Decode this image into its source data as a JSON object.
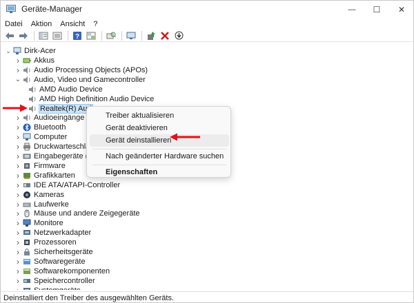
{
  "window": {
    "title": "Geräte-Manager",
    "controls": {
      "minimize": "—",
      "maximize": "☐",
      "close": "✕"
    }
  },
  "menubar": {
    "items": [
      "Datei",
      "Aktion",
      "Ansicht",
      "?"
    ]
  },
  "toolbar": {
    "buttons": [
      "back-arrow-icon",
      "forward-arrow-icon",
      "properties-view-icon",
      "list-view-icon",
      "help-icon",
      "grid-view-icon",
      "scan-hardware-icon",
      "monitor-icon",
      "add-driver-icon",
      "remove-device-icon",
      "download-icon"
    ]
  },
  "tree": {
    "root": "Dirk-Acer",
    "items": [
      {
        "label": "Akkus",
        "icon": "battery-icon",
        "expanded": false
      },
      {
        "label": "Audio Processing Objects (APOs)",
        "icon": "speaker-icon",
        "expanded": false
      },
      {
        "label": "Audio, Video und Gamecontroller",
        "icon": "speaker-icon",
        "expanded": true
      },
      {
        "label": "AMD Audio Device",
        "icon": "speaker-icon",
        "child": true
      },
      {
        "label": "AMD High Definition Audio Device",
        "icon": "speaker-icon",
        "child": true
      },
      {
        "label": "Realtek(R) Aud",
        "icon": "speaker-icon",
        "child": true,
        "selected": true
      },
      {
        "label": "Audioeingänge ur",
        "icon": "speaker-icon",
        "expanded": false
      },
      {
        "label": "Bluetooth",
        "icon": "bluetooth-icon",
        "expanded": false
      },
      {
        "label": "Computer",
        "icon": "computer-icon",
        "expanded": false
      },
      {
        "label": "Druckwarteschlang",
        "icon": "printer-icon",
        "expanded": false
      },
      {
        "label": "Eingabegeräte (Hu",
        "icon": "keyboard-icon",
        "expanded": false
      },
      {
        "label": "Firmware",
        "icon": "chip-icon",
        "expanded": false
      },
      {
        "label": "Grafikkarten",
        "icon": "display-adapter-icon",
        "expanded": false
      },
      {
        "label": "IDE ATA/ATAPI-Controller",
        "icon": "controller-icon",
        "expanded": false
      },
      {
        "label": "Kameras",
        "icon": "camera-icon",
        "expanded": false
      },
      {
        "label": "Laufwerke",
        "icon": "drive-icon",
        "expanded": false
      },
      {
        "label": "Mäuse und andere Zeigegeräte",
        "icon": "mouse-icon",
        "expanded": false
      },
      {
        "label": "Monitore",
        "icon": "monitor-icon",
        "expanded": false
      },
      {
        "label": "Netzwerkadapter",
        "icon": "network-icon",
        "expanded": false
      },
      {
        "label": "Prozessoren",
        "icon": "cpu-icon",
        "expanded": false
      },
      {
        "label": "Sicherheitsgeräte",
        "icon": "security-icon",
        "expanded": false
      },
      {
        "label": "Softwaregeräte",
        "icon": "software-device-icon",
        "expanded": false
      },
      {
        "label": "Softwarekomponenten",
        "icon": "software-component-icon",
        "expanded": false
      },
      {
        "label": "Speichercontroller",
        "icon": "storage-icon",
        "expanded": false
      },
      {
        "label": "Systemgeräte",
        "icon": "system-icon",
        "expanded": false
      }
    ]
  },
  "context_menu": {
    "items": [
      {
        "label": "Treiber aktualisieren"
      },
      {
        "label": "Gerät deaktivieren"
      },
      {
        "label": "Gerät deinstallieren",
        "highlighted": true
      },
      {
        "label": "Nach geänderter Hardware suchen"
      },
      {
        "label": "Eigenschaften",
        "bold": true
      }
    ]
  },
  "statusbar": {
    "text": "Deinstalliert den Treiber des ausgewählten Geräts."
  },
  "colors": {
    "accent_arrow": "#e0121b",
    "selection": "#cce4f7"
  }
}
